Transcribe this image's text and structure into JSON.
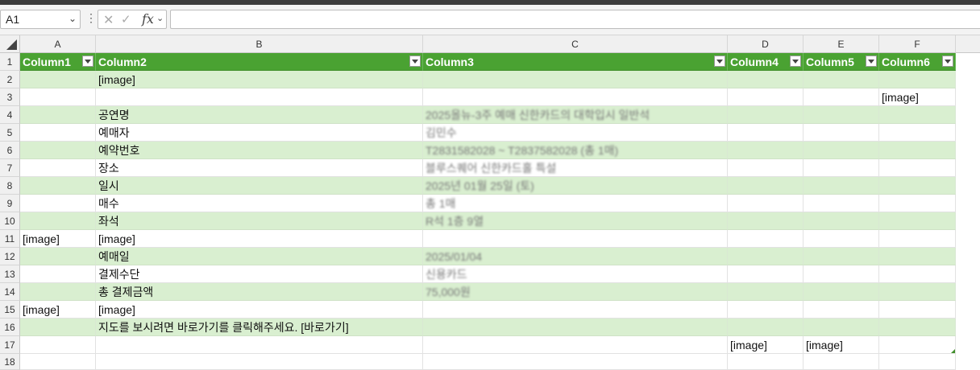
{
  "namebox": {
    "value": "A1"
  },
  "fx_label": "fx",
  "columns": [
    "A",
    "B",
    "C",
    "D",
    "E",
    "F"
  ],
  "rows": [
    "1",
    "2",
    "3",
    "4",
    "5",
    "6",
    "7",
    "8",
    "9",
    "10",
    "11",
    "12",
    "13",
    "14",
    "15",
    "16",
    "17",
    "18"
  ],
  "table_headers": [
    "Column1",
    "Column2",
    "Column3",
    "Column4",
    "Column5",
    "Column6"
  ],
  "cells": {
    "B2": "[image]",
    "F3": "[image]",
    "B4": "공연명",
    "C4": "2025올뉴-3주 예매 신한카드의 대학입시 일반석",
    "B5": "예매자",
    "C5": "김민수",
    "B6": "예약번호",
    "C6": "T2831582028 ~ T2837582028 (총 1매)",
    "B7": "장소",
    "C7": "블루스퀘어 신한카드홀 특설",
    "B8": "일시",
    "C8": "2025년 01월 25일 (토)",
    "B9": "매수",
    "C9": "총 1매",
    "B10": "좌석",
    "C10": "R석 1층 9열",
    "A11": "[image]",
    "B11": "[image]",
    "B12": "예매일",
    "C12": "2025/01/04",
    "B13": "결제수단",
    "C13": "신용카드",
    "B14": "총 결제금액",
    "C14": "75,000원",
    "A15": "[image]",
    "B15": "[image]",
    "B16": "지도를 보시려면 바로가기를 클릭해주세요. [바로가기]",
    "D17": "[image]",
    "E17": "[image]"
  }
}
